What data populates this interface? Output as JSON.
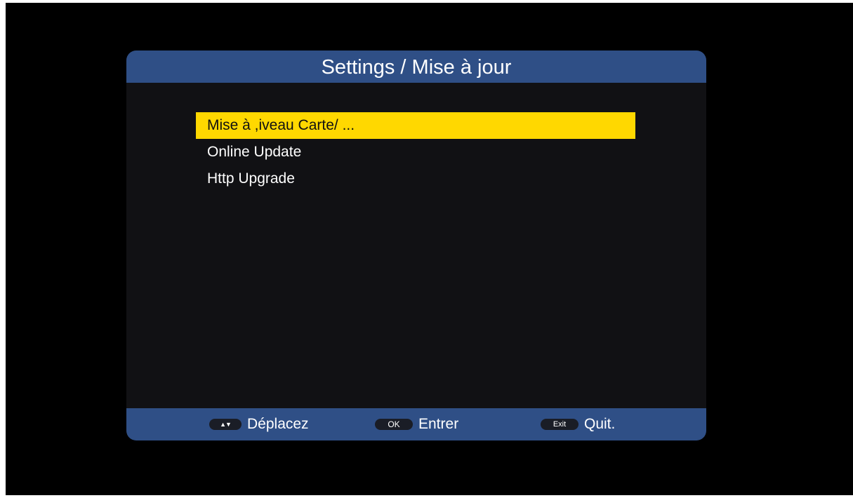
{
  "header": {
    "title": "Settings / Mise à jour"
  },
  "menu": {
    "items": [
      {
        "label": "Mise à ,iveau Carte/ ...",
        "selected": true
      },
      {
        "label": "Online Update",
        "selected": false
      },
      {
        "label": "Http Upgrade",
        "selected": false
      }
    ]
  },
  "footer": {
    "hints": [
      {
        "key": "▲▼",
        "label": "Déplacez",
        "icon": "up-down-arrows-icon"
      },
      {
        "key": "OK",
        "label": "Entrer",
        "icon": "ok-key-icon"
      },
      {
        "key": "Exit",
        "label": "Quit.",
        "icon": "exit-key-icon"
      }
    ]
  },
  "colors": {
    "header_bg": "#2f4f86",
    "panel_bg": "#111114",
    "highlight": "#ffd800",
    "background": "#000000"
  }
}
